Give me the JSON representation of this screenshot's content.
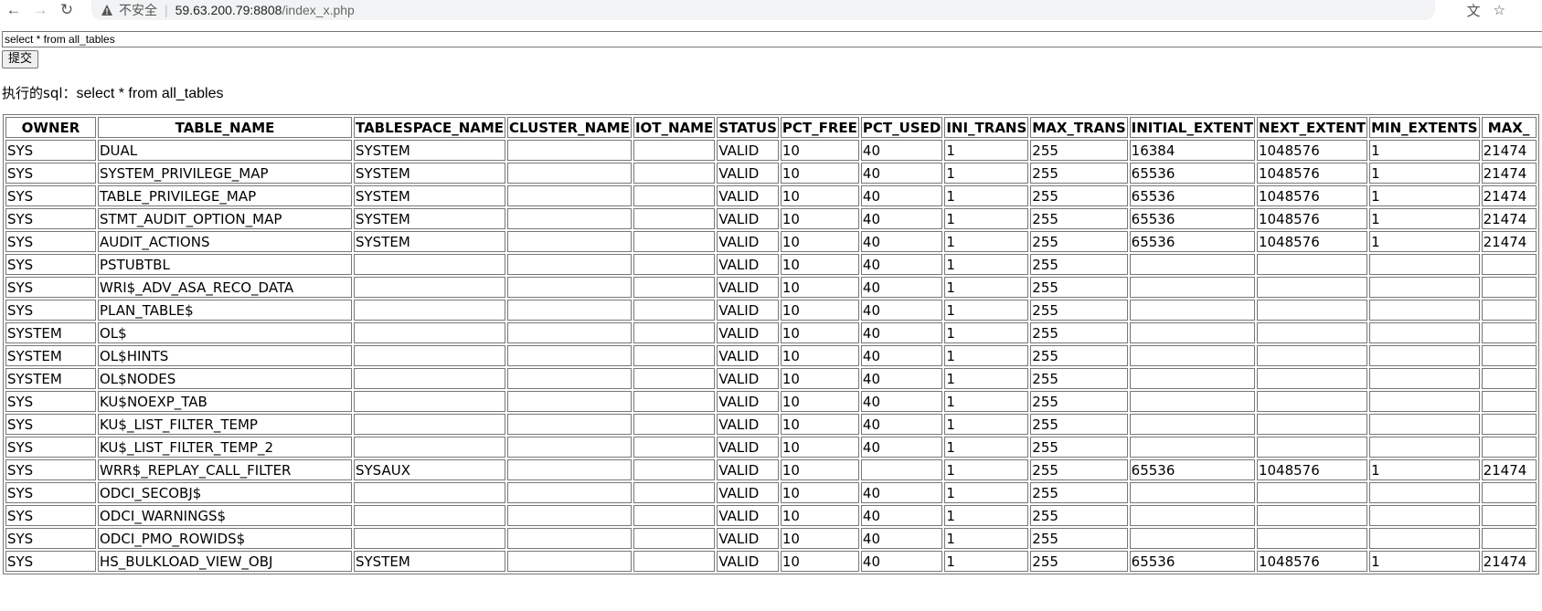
{
  "browser": {
    "back_icon": "arrow-left-icon",
    "forward_icon": "arrow-right-icon",
    "reload_icon": "reload-icon",
    "security_label": "不安全",
    "url_host": "59.63.200.79:8808",
    "url_path": "/index_x.php",
    "translate_icon": "translate-icon",
    "bookmark_icon": "star-icon"
  },
  "form": {
    "sql_value": "select * from all_tables",
    "submit_label": "提交"
  },
  "exec": {
    "prefix": "执行的sql：",
    "sql": "select * from all_tables"
  },
  "table": {
    "columns": [
      "OWNER",
      "TABLE_NAME",
      "TABLESPACE_NAME",
      "CLUSTER_NAME",
      "IOT_NAME",
      "STATUS",
      "PCT_FREE",
      "PCT_USED",
      "INI_TRANS",
      "MAX_TRANS",
      "INITIAL_EXTENT",
      "NEXT_EXTENT",
      "MIN_EXTENTS",
      "MAX_"
    ],
    "rows": [
      [
        "SYS",
        "DUAL",
        "SYSTEM",
        "",
        "",
        "VALID",
        "10",
        "40",
        "1",
        "255",
        "16384",
        "1048576",
        "1",
        "21474"
      ],
      [
        "SYS",
        "SYSTEM_PRIVILEGE_MAP",
        "SYSTEM",
        "",
        "",
        "VALID",
        "10",
        "40",
        "1",
        "255",
        "65536",
        "1048576",
        "1",
        "21474"
      ],
      [
        "SYS",
        "TABLE_PRIVILEGE_MAP",
        "SYSTEM",
        "",
        "",
        "VALID",
        "10",
        "40",
        "1",
        "255",
        "65536",
        "1048576",
        "1",
        "21474"
      ],
      [
        "SYS",
        "STMT_AUDIT_OPTION_MAP",
        "SYSTEM",
        "",
        "",
        "VALID",
        "10",
        "40",
        "1",
        "255",
        "65536",
        "1048576",
        "1",
        "21474"
      ],
      [
        "SYS",
        "AUDIT_ACTIONS",
        "SYSTEM",
        "",
        "",
        "VALID",
        "10",
        "40",
        "1",
        "255",
        "65536",
        "1048576",
        "1",
        "21474"
      ],
      [
        "SYS",
        "PSTUBTBL",
        "",
        "",
        "",
        "VALID",
        "10",
        "40",
        "1",
        "255",
        "",
        "",
        "",
        ""
      ],
      [
        "SYS",
        "WRI$_ADV_ASA_RECO_DATA",
        "",
        "",
        "",
        "VALID",
        "10",
        "40",
        "1",
        "255",
        "",
        "",
        "",
        ""
      ],
      [
        "SYS",
        "PLAN_TABLE$",
        "",
        "",
        "",
        "VALID",
        "10",
        "40",
        "1",
        "255",
        "",
        "",
        "",
        ""
      ],
      [
        "SYSTEM",
        "OL$",
        "",
        "",
        "",
        "VALID",
        "10",
        "40",
        "1",
        "255",
        "",
        "",
        "",
        ""
      ],
      [
        "SYSTEM",
        "OL$HINTS",
        "",
        "",
        "",
        "VALID",
        "10",
        "40",
        "1",
        "255",
        "",
        "",
        "",
        ""
      ],
      [
        "SYSTEM",
        "OL$NODES",
        "",
        "",
        "",
        "VALID",
        "10",
        "40",
        "1",
        "255",
        "",
        "",
        "",
        ""
      ],
      [
        "SYS",
        "KU$NOEXP_TAB",
        "",
        "",
        "",
        "VALID",
        "10",
        "40",
        "1",
        "255",
        "",
        "",
        "",
        ""
      ],
      [
        "SYS",
        "KU$_LIST_FILTER_TEMP",
        "",
        "",
        "",
        "VALID",
        "10",
        "40",
        "1",
        "255",
        "",
        "",
        "",
        ""
      ],
      [
        "SYS",
        "KU$_LIST_FILTER_TEMP_2",
        "",
        "",
        "",
        "VALID",
        "10",
        "40",
        "1",
        "255",
        "",
        "",
        "",
        ""
      ],
      [
        "SYS",
        "WRR$_REPLAY_CALL_FILTER",
        "SYSAUX",
        "",
        "",
        "VALID",
        "10",
        "",
        "1",
        "255",
        "65536",
        "1048576",
        "1",
        "21474"
      ],
      [
        "SYS",
        "ODCI_SECOBJ$",
        "",
        "",
        "",
        "VALID",
        "10",
        "40",
        "1",
        "255",
        "",
        "",
        "",
        ""
      ],
      [
        "SYS",
        "ODCI_WARNINGS$",
        "",
        "",
        "",
        "VALID",
        "10",
        "40",
        "1",
        "255",
        "",
        "",
        "",
        ""
      ],
      [
        "SYS",
        "ODCI_PMO_ROWIDS$",
        "",
        "",
        "",
        "VALID",
        "10",
        "40",
        "1",
        "255",
        "",
        "",
        "",
        ""
      ],
      [
        "SYS",
        "HS_BULKLOAD_VIEW_OBJ",
        "SYSTEM",
        "",
        "",
        "VALID",
        "10",
        "40",
        "1",
        "255",
        "65536",
        "1048576",
        "1",
        "21474"
      ]
    ]
  }
}
